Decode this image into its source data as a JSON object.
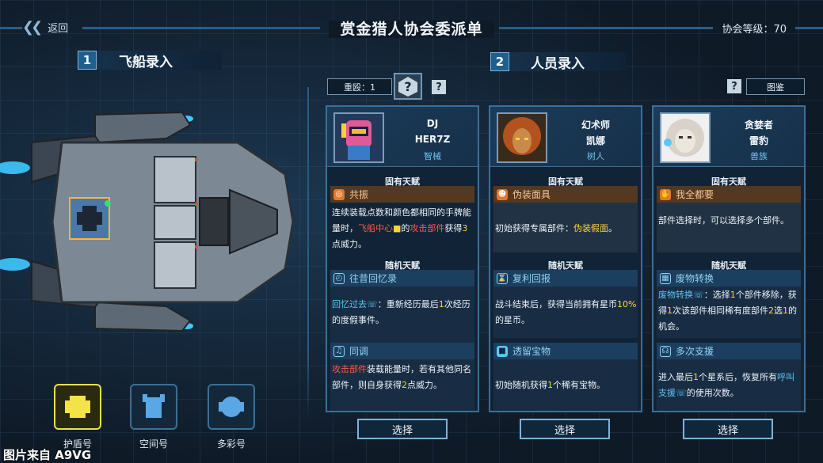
{
  "header": {
    "back_label": "返回",
    "title": "赏金猎人协会委派单",
    "level_label": "协会等级：70"
  },
  "ship_section": {
    "number": "1",
    "label": "飞船录入",
    "ships": [
      {
        "name": "护盾号",
        "selected": true
      },
      {
        "name": "空间号",
        "selected": false
      },
      {
        "name": "多彩号",
        "selected": false
      }
    ]
  },
  "crew_section": {
    "number": "2",
    "label": "人员录入",
    "difficulty_label": "重殴：1",
    "help_label": "?",
    "codex_label": "图鉴"
  },
  "cards": [
    {
      "name1": "DJ",
      "name2": "HER7Z",
      "race": "智械",
      "inherent_header": "固有天赋",
      "inherent": {
        "name": "共振",
        "desc": [
          "连续装载点数和颜色都相同的手牌能量时，",
          "飞船中心",
          "的",
          "攻击部件",
          "获得",
          "3",
          "点威力。"
        ]
      },
      "random_header": "随机天赋",
      "random": [
        {
          "name": "往昔回忆录",
          "desc": [
            "回忆过去",
            "：重新经历最后",
            "1",
            "次经历的度假事件。"
          ]
        },
        {
          "name": "同调",
          "desc": [
            "攻击部件",
            "装载能量时，若有其他同名部件，则自身获得",
            "2",
            "点威力。"
          ]
        }
      ],
      "select_label": "选择"
    },
    {
      "name1": "幻术师",
      "name2": "凯娜",
      "race": "树人",
      "inherent_header": "固有天赋",
      "inherent": {
        "name": "伪装面具",
        "desc": [
          "初始获得专属部件：",
          "伪装假面",
          "。"
        ]
      },
      "random_header": "随机天赋",
      "random": [
        {
          "name": "复利回报",
          "desc": [
            "战斗结束后，获得当前拥有星币",
            "10%",
            "的星币。"
          ]
        },
        {
          "name": "透留宝物",
          "desc": [
            "初始随机获得",
            "1",
            "个稀有宝物。"
          ]
        }
      ],
      "select_label": "选择"
    },
    {
      "name1": "贪婪者",
      "name2": "雷豹",
      "race": "兽族",
      "inherent_header": "固有天赋",
      "inherent": {
        "name": "我全都要",
        "desc": [
          "部件选择时，可以选择多个部件。"
        ]
      },
      "random_header": "随机天赋",
      "random": [
        {
          "name": "废物转换",
          "desc": [
            "废物转换",
            "：选择",
            "1",
            "个部件移除，获得",
            "1",
            "次该部件相同稀有度部件",
            "2",
            "选",
            "1",
            "的机会。"
          ]
        },
        {
          "name": "多次支援",
          "desc": [
            "进入最后",
            "1",
            "个星系后，恢复所有",
            "呼叫支援",
            "的使用次数。"
          ]
        }
      ],
      "select_label": "选择"
    }
  ],
  "watermark": "图片来自 A9VG",
  "colors": {
    "accent": "#3b6f98",
    "inherent": "#54381f",
    "random": "#1d3f5f",
    "highlight_red": "#ff5a4a",
    "highlight_yellow": "#ffd23c",
    "highlight_blue": "#5cc6f5"
  }
}
